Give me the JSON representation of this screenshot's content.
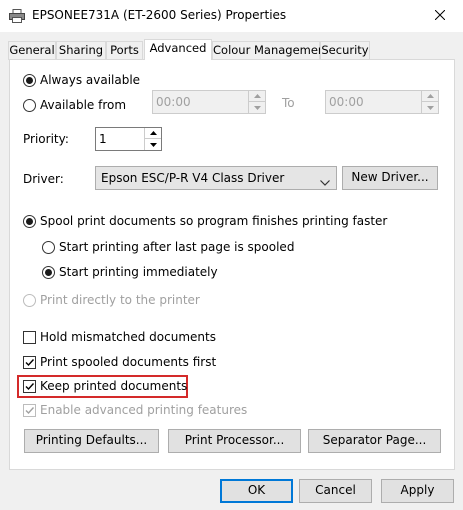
{
  "window": {
    "title": "EPSONEE731A (ET-2600 Series) Properties"
  },
  "tabs": [
    "General",
    "Sharing",
    "Ports",
    "Advanced",
    "Colour Management",
    "Security"
  ],
  "active_tab": "Advanced",
  "availability": {
    "always_label": "Always available",
    "always_checked": true,
    "from_label": "Available from",
    "from_checked": false,
    "from_time": "00:00",
    "to_label": "To",
    "to_time": "00:00"
  },
  "priority": {
    "label": "Priority:",
    "value": "1"
  },
  "driver": {
    "label": "Driver:",
    "value": "Epson ESC/P-R V4 Class Driver",
    "new_driver_button": "New Driver..."
  },
  "spool": {
    "spool_label": "Spool print documents so program finishes printing faster",
    "spool_checked": true,
    "after_last_page_label": "Start printing after last page is spooled",
    "after_last_page_checked": false,
    "immediately_label": "Start printing immediately",
    "immediately_checked": true,
    "direct_label": "Print directly to the printer",
    "direct_checked": false
  },
  "options": [
    {
      "label": "Hold mismatched documents",
      "checked": false,
      "enabled": true
    },
    {
      "label": "Print spooled documents first",
      "checked": true,
      "enabled": true
    },
    {
      "label": "Keep printed documents",
      "checked": true,
      "enabled": true,
      "highlighted": true
    },
    {
      "label": "Enable advanced printing features",
      "checked": true,
      "enabled": false
    }
  ],
  "panel_buttons": {
    "defaults": "Printing Defaults...",
    "processor": "Print Processor...",
    "separator": "Separator Page..."
  },
  "footer": {
    "ok": "OK",
    "cancel": "Cancel",
    "apply": "Apply"
  },
  "colors": {
    "highlight": "#d42a2a",
    "default_button_border": "#0078d7"
  },
  "icons": {
    "app": "printer-icon",
    "close": "close-icon"
  }
}
